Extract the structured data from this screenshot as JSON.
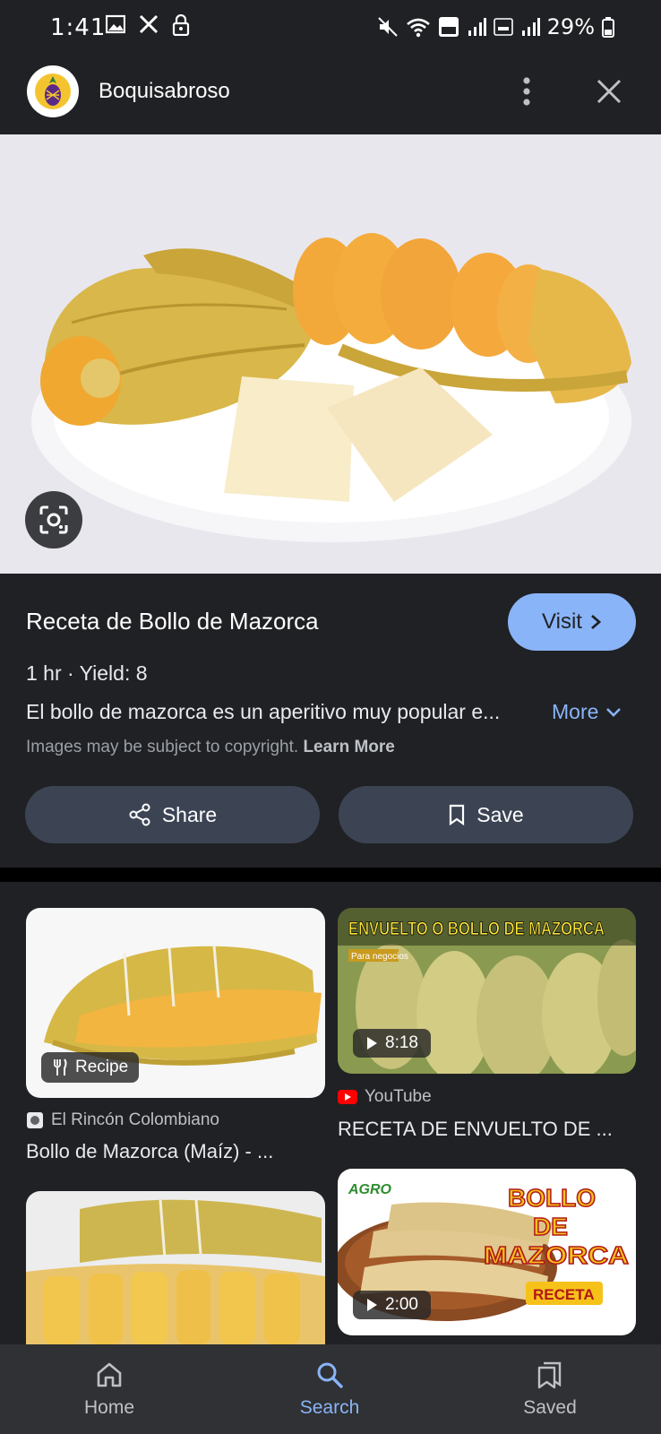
{
  "status_bar": {
    "time": "1:41",
    "battery": "29%"
  },
  "header": {
    "site_name": "Boquisabroso"
  },
  "result": {
    "title": "Receta de Bollo de Mazorca",
    "visit_label": "Visit",
    "meta": "1 hr · Yield: 8",
    "description": "El bollo de mazorca es un aperitivo muy popular e...",
    "more_label": "More",
    "copyright_text": "Images may be subject to copyright.",
    "learn_more_label": "Learn More",
    "share_label": "Share",
    "save_label": "Save"
  },
  "related": [
    {
      "badge": "Recipe",
      "source": "El Rincón Colombiano",
      "title": "Bollo de Mazorca (Maíz) - ..."
    },
    {
      "overlay_title": "ENVUELTO O BOLLO DE MAZORCA",
      "overlay_sub": "Para negocios",
      "duration": "8:18",
      "source": "YouTube",
      "title": "RECETA DE ENVUELTO DE ..."
    },
    {
      "overlay_brand": "AGRO",
      "overlay_line1": "BOLLO",
      "overlay_line2": "DE",
      "overlay_line3": "MAZORCA",
      "overlay_tag": "RECETA",
      "duration": "2:00"
    }
  ],
  "bottom_nav": {
    "home": "Home",
    "search": "Search",
    "saved": "Saved"
  },
  "colors": {
    "accent": "#8ab4f8",
    "background": "#202124",
    "pill": "#3c4454"
  }
}
